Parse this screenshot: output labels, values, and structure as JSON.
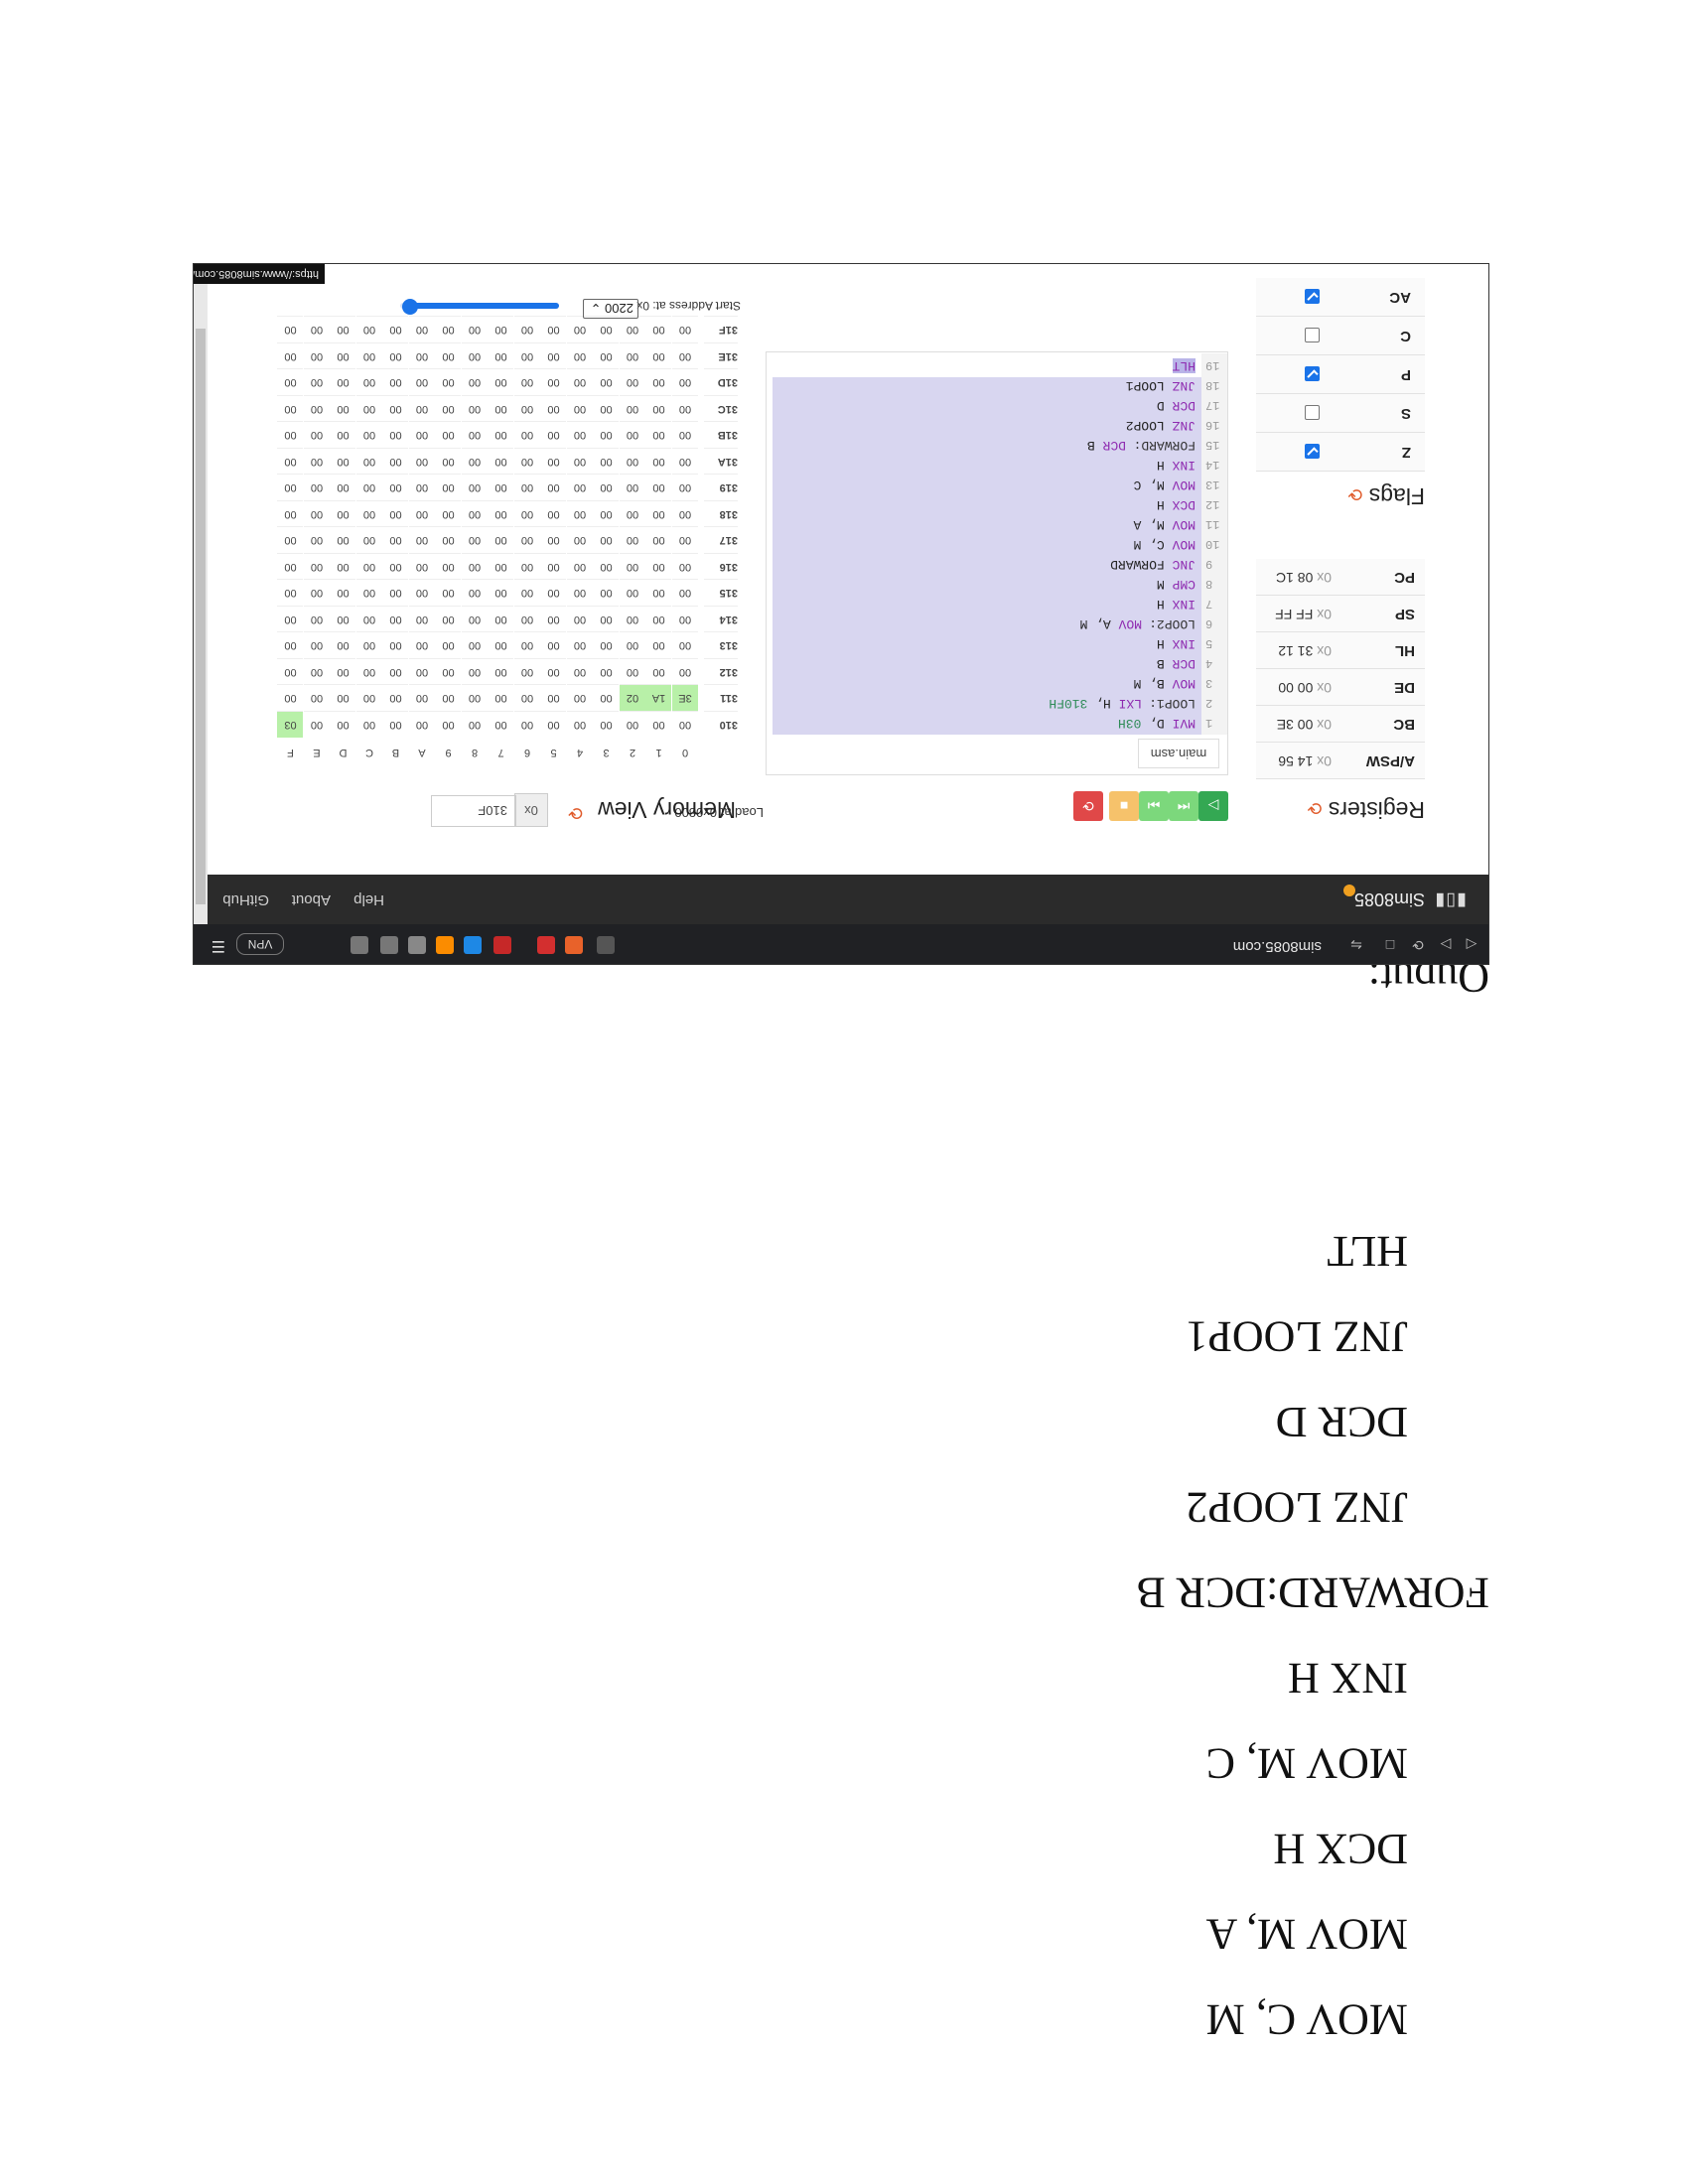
{
  "document": {
    "lines": [
      "MOV C, M",
      "MOV M, A",
      "DCX H",
      "MOV M, C",
      "INX H",
      "FORWARD:DCR B",
      "JNZ LOOP2",
      "DCR D",
      "JNZ LOOP1",
      "HLT"
    ],
    "output_label": "Ouput:"
  },
  "browser": {
    "url": "sim8085.com",
    "vpn_label": "VPN",
    "status_url": "https://www.sim8085.com/#"
  },
  "app": {
    "brand": "Sim8085",
    "nav": [
      "Help",
      "About",
      "GitHub"
    ]
  },
  "registers": {
    "title": "Registers",
    "rows": [
      {
        "name": "A/PSW",
        "prefix": "0x",
        "value": "14 56"
      },
      {
        "name": "BC",
        "prefix": "0x",
        "value": "00 3E"
      },
      {
        "name": "DE",
        "prefix": "0x",
        "value": "00 00"
      },
      {
        "name": "HL",
        "prefix": "0x",
        "value": "31 12"
      },
      {
        "name": "SP",
        "prefix": "0x",
        "value": "FF FF"
      },
      {
        "name": "PC",
        "prefix": "0x",
        "value": "08 1C"
      }
    ]
  },
  "flags": {
    "title": "Flags",
    "rows": [
      {
        "name": "Z",
        "checked": true
      },
      {
        "name": "S",
        "checked": false
      },
      {
        "name": "P",
        "checked": true
      },
      {
        "name": "C",
        "checked": false
      },
      {
        "name": "AC",
        "checked": true
      }
    ]
  },
  "toolbar": {
    "load_label": "Load at 0x0800",
    "colors": {
      "run": "#34a853",
      "step": "#7cd87c",
      "pause": "#f6c26b",
      "reset": "#e04848"
    }
  },
  "editor": {
    "tab": "main.asm",
    "lines": [
      {
        "n": "1",
        "label": "",
        "op": "MVI",
        "args": "D, ",
        "num": "03H"
      },
      {
        "n": "2",
        "label": "LOOP1:",
        "op": "LXI",
        "args": "H, ",
        "num": "310FH"
      },
      {
        "n": "3",
        "label": "",
        "op": "MOV",
        "args": "B, M",
        "num": ""
      },
      {
        "n": "4",
        "label": "",
        "op": "DCR",
        "args": "B",
        "num": ""
      },
      {
        "n": "5",
        "label": "",
        "op": "INX",
        "args": "H",
        "num": ""
      },
      {
        "n": "6",
        "label": "LOOP2:",
        "op": "MOV",
        "args": "A, M",
        "num": ""
      },
      {
        "n": "7",
        "label": "",
        "op": "INX",
        "args": "H",
        "num": ""
      },
      {
        "n": "8",
        "label": "",
        "op": "CMP",
        "args": "M",
        "num": ""
      },
      {
        "n": "9",
        "label": "",
        "op": "JNC",
        "args": "FORWARD",
        "num": ""
      },
      {
        "n": "10",
        "label": "",
        "op": "MOV",
        "args": "C, M",
        "num": ""
      },
      {
        "n": "11",
        "label": "",
        "op": "MOV",
        "args": "M, A",
        "num": ""
      },
      {
        "n": "12",
        "label": "",
        "op": "DCX",
        "args": "H",
        "num": ""
      },
      {
        "n": "13",
        "label": "",
        "op": "MOV",
        "args": "M, C",
        "num": ""
      },
      {
        "n": "14",
        "label": "",
        "op": "INX",
        "args": "H",
        "num": ""
      },
      {
        "n": "15",
        "label": "FORWARD:",
        "op": "DCR",
        "args": "B",
        "num": ""
      },
      {
        "n": "16",
        "label": "",
        "op": "JNZ",
        "args": "LOOP2",
        "num": ""
      },
      {
        "n": "17",
        "label": "",
        "op": "DCR",
        "args": "D",
        "num": ""
      },
      {
        "n": "18",
        "label": "",
        "op": "JNZ",
        "args": "LOOP1",
        "num": ""
      },
      {
        "n": "19",
        "label": "",
        "op": "HLT",
        "args": "",
        "num": ""
      }
    ]
  },
  "memory": {
    "title": "Memory View",
    "prefix": "0x",
    "address_input": "310F",
    "col_headers": [
      "0",
      "1",
      "2",
      "3",
      "4",
      "5",
      "6",
      "7",
      "8",
      "9",
      "A",
      "B",
      "C",
      "D",
      "E",
      "F"
    ],
    "rows": [
      {
        "addr": "310",
        "cells": [
          "00",
          "00",
          "00",
          "00",
          "00",
          "00",
          "00",
          "00",
          "00",
          "00",
          "00",
          "00",
          "00",
          "00",
          "00",
          "03"
        ],
        "hl": [
          15
        ]
      },
      {
        "addr": "311",
        "cells": [
          "3E",
          "1A",
          "02",
          "00",
          "00",
          "00",
          "00",
          "00",
          "00",
          "00",
          "00",
          "00",
          "00",
          "00",
          "00",
          "00"
        ],
        "hl": [
          0,
          1,
          2
        ]
      },
      {
        "addr": "312",
        "cells": [
          "00",
          "00",
          "00",
          "00",
          "00",
          "00",
          "00",
          "00",
          "00",
          "00",
          "00",
          "00",
          "00",
          "00",
          "00",
          "00"
        ],
        "hl": []
      },
      {
        "addr": "313",
        "cells": [
          "00",
          "00",
          "00",
          "00",
          "00",
          "00",
          "00",
          "00",
          "00",
          "00",
          "00",
          "00",
          "00",
          "00",
          "00",
          "00"
        ],
        "hl": []
      },
      {
        "addr": "314",
        "cells": [
          "00",
          "00",
          "00",
          "00",
          "00",
          "00",
          "00",
          "00",
          "00",
          "00",
          "00",
          "00",
          "00",
          "00",
          "00",
          "00"
        ],
        "hl": []
      },
      {
        "addr": "315",
        "cells": [
          "00",
          "00",
          "00",
          "00",
          "00",
          "00",
          "00",
          "00",
          "00",
          "00",
          "00",
          "00",
          "00",
          "00",
          "00",
          "00"
        ],
        "hl": []
      },
      {
        "addr": "316",
        "cells": [
          "00",
          "00",
          "00",
          "00",
          "00",
          "00",
          "00",
          "00",
          "00",
          "00",
          "00",
          "00",
          "00",
          "00",
          "00",
          "00"
        ],
        "hl": []
      },
      {
        "addr": "317",
        "cells": [
          "00",
          "00",
          "00",
          "00",
          "00",
          "00",
          "00",
          "00",
          "00",
          "00",
          "00",
          "00",
          "00",
          "00",
          "00",
          "00"
        ],
        "hl": []
      },
      {
        "addr": "318",
        "cells": [
          "00",
          "00",
          "00",
          "00",
          "00",
          "00",
          "00",
          "00",
          "00",
          "00",
          "00",
          "00",
          "00",
          "00",
          "00",
          "00"
        ],
        "hl": []
      },
      {
        "addr": "319",
        "cells": [
          "00",
          "00",
          "00",
          "00",
          "00",
          "00",
          "00",
          "00",
          "00",
          "00",
          "00",
          "00",
          "00",
          "00",
          "00",
          "00"
        ],
        "hl": []
      },
      {
        "addr": "31A",
        "cells": [
          "00",
          "00",
          "00",
          "00",
          "00",
          "00",
          "00",
          "00",
          "00",
          "00",
          "00",
          "00",
          "00",
          "00",
          "00",
          "00"
        ],
        "hl": []
      },
      {
        "addr": "31B",
        "cells": [
          "00",
          "00",
          "00",
          "00",
          "00",
          "00",
          "00",
          "00",
          "00",
          "00",
          "00",
          "00",
          "00",
          "00",
          "00",
          "00"
        ],
        "hl": []
      },
      {
        "addr": "31C",
        "cells": [
          "00",
          "00",
          "00",
          "00",
          "00",
          "00",
          "00",
          "00",
          "00",
          "00",
          "00",
          "00",
          "00",
          "00",
          "00",
          "00"
        ],
        "hl": []
      },
      {
        "addr": "31D",
        "cells": [
          "00",
          "00",
          "00",
          "00",
          "00",
          "00",
          "00",
          "00",
          "00",
          "00",
          "00",
          "00",
          "00",
          "00",
          "00",
          "00"
        ],
        "hl": []
      },
      {
        "addr": "31E",
        "cells": [
          "00",
          "00",
          "00",
          "00",
          "00",
          "00",
          "00",
          "00",
          "00",
          "00",
          "00",
          "00",
          "00",
          "00",
          "00",
          "00"
        ],
        "hl": []
      },
      {
        "addr": "31F",
        "cells": [
          "00",
          "00",
          "00",
          "00",
          "00",
          "00",
          "00",
          "00",
          "00",
          "00",
          "00",
          "00",
          "00",
          "00",
          "00",
          "00"
        ],
        "hl": []
      }
    ],
    "start_address_label": "Start Address at: 0x",
    "start_address_value": "2200",
    "slider_fraction": 0.06
  }
}
